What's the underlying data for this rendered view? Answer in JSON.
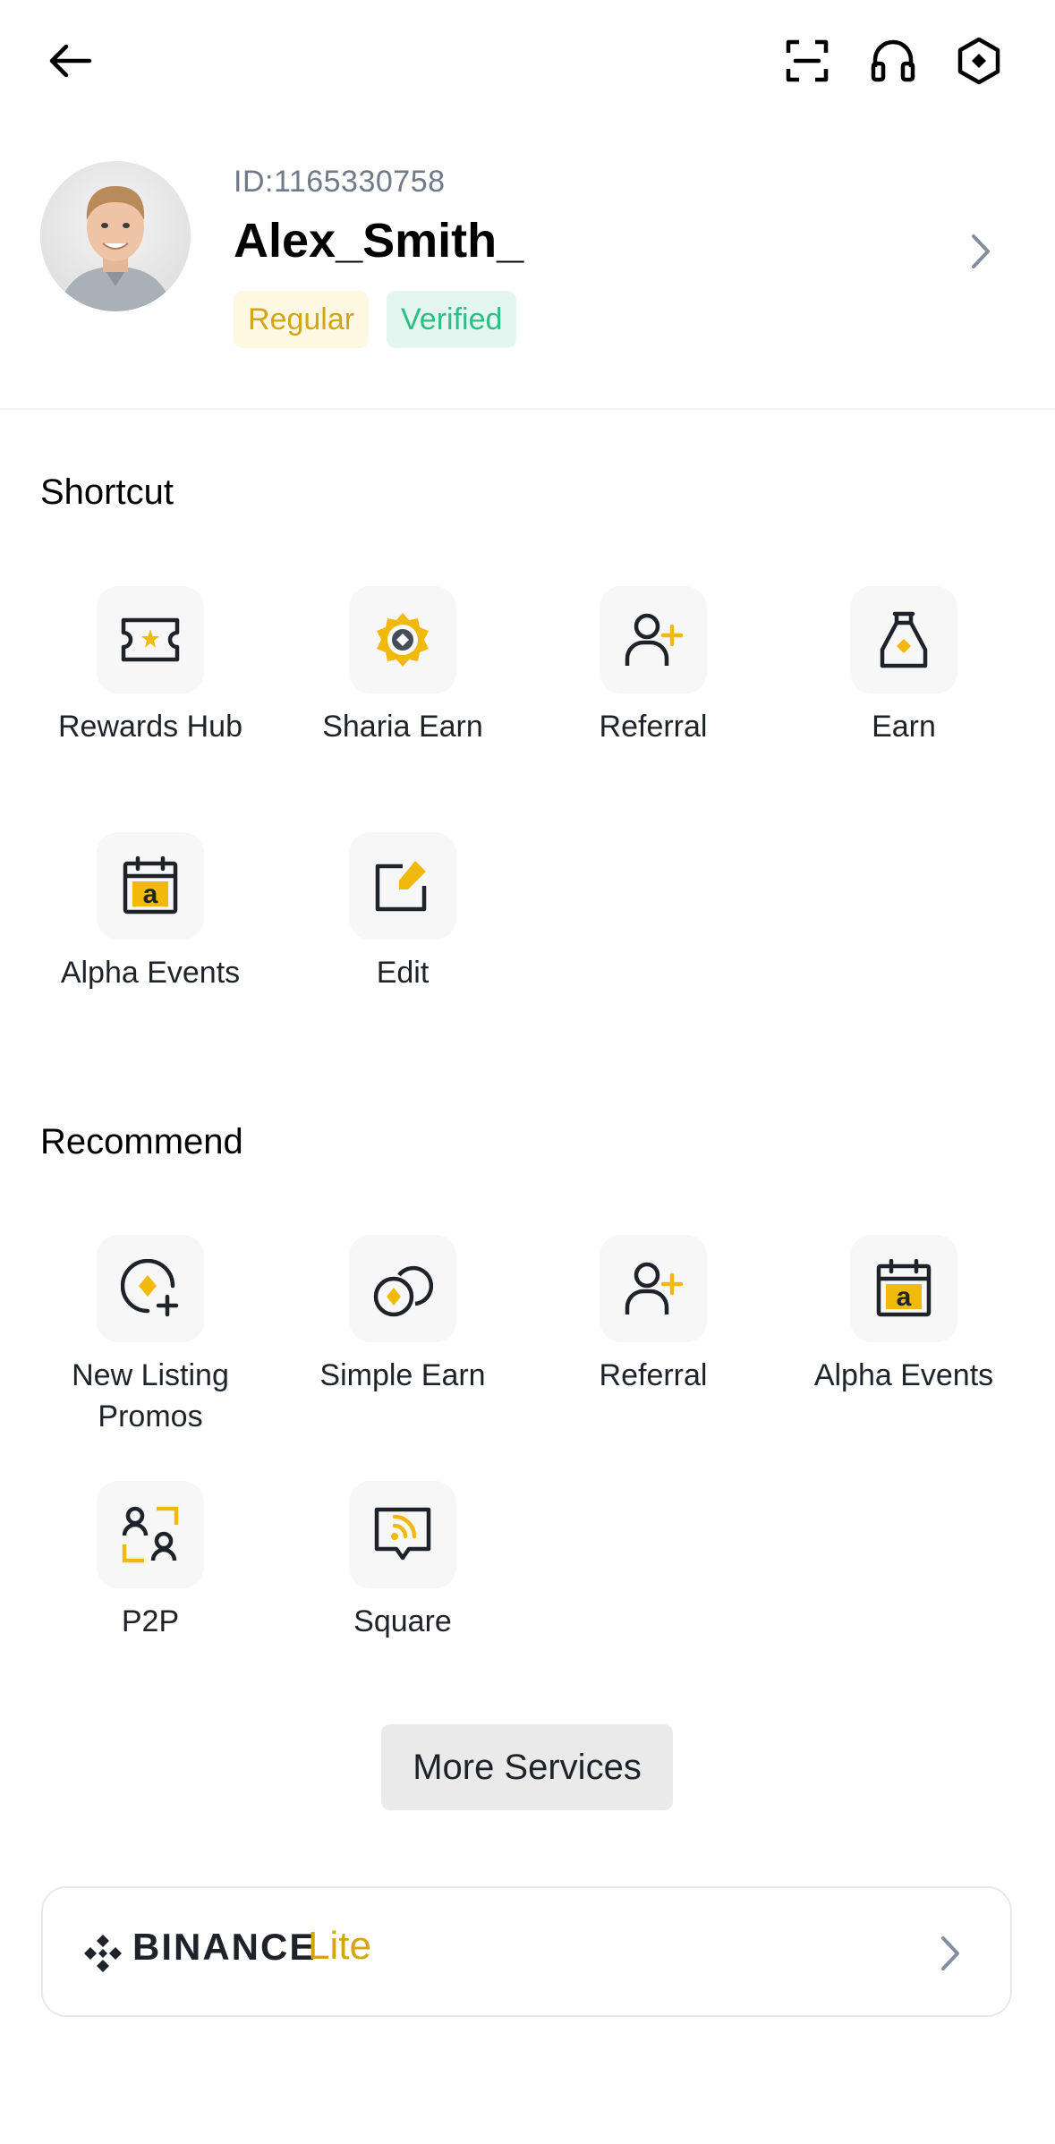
{
  "header": {
    "back_icon": "arrow-left-icon",
    "scan_icon": "scan-icon",
    "support_icon": "headset-icon",
    "settings_icon": "settings-hexagon-icon"
  },
  "profile": {
    "id_text": "ID:1165330758",
    "username": "Alex_Smith_",
    "badges": [
      {
        "label": "Regular",
        "color": "#d4a514",
        "background": "#fef8e3"
      },
      {
        "label": "Verified",
        "color": "#2ebd85",
        "background": "#e3f7f0"
      }
    ],
    "chevron_icon": "chevron-right-icon"
  },
  "shortcut": {
    "title": "Shortcut",
    "items": [
      {
        "label": "Rewards Hub",
        "icon": "ticket-star-icon"
      },
      {
        "label": "Sharia Earn",
        "icon": "sharia-badge-icon"
      },
      {
        "label": "Referral",
        "icon": "user-add-icon"
      },
      {
        "label": "Earn",
        "icon": "money-bag-icon"
      },
      {
        "label": "Alpha Events",
        "icon": "calendar-alpha-icon"
      },
      {
        "label": "Edit",
        "icon": "edit-icon"
      }
    ]
  },
  "recommend": {
    "title": "Recommend",
    "items": [
      {
        "label": "New Listing Promos",
        "icon": "coin-plus-icon"
      },
      {
        "label": "Simple Earn",
        "icon": "coins-icon"
      },
      {
        "label": "Referral",
        "icon": "user-add-icon"
      },
      {
        "label": "Alpha Events",
        "icon": "calendar-alpha-icon"
      },
      {
        "label": "P2P",
        "icon": "p2p-users-icon"
      },
      {
        "label": "Square",
        "icon": "square-chat-icon"
      }
    ]
  },
  "more_services_label": "More Services",
  "lite_card": {
    "brand": "BINANCE",
    "suffix": "Lite",
    "logo_icon": "binance-logo-icon",
    "chevron_icon": "chevron-right-icon"
  },
  "colors": {
    "accent": "#f0b90b",
    "accent_text": "#d4a514",
    "verified": "#2ebd85",
    "text_primary": "#1e2329",
    "text_secondary": "#707a8a"
  }
}
